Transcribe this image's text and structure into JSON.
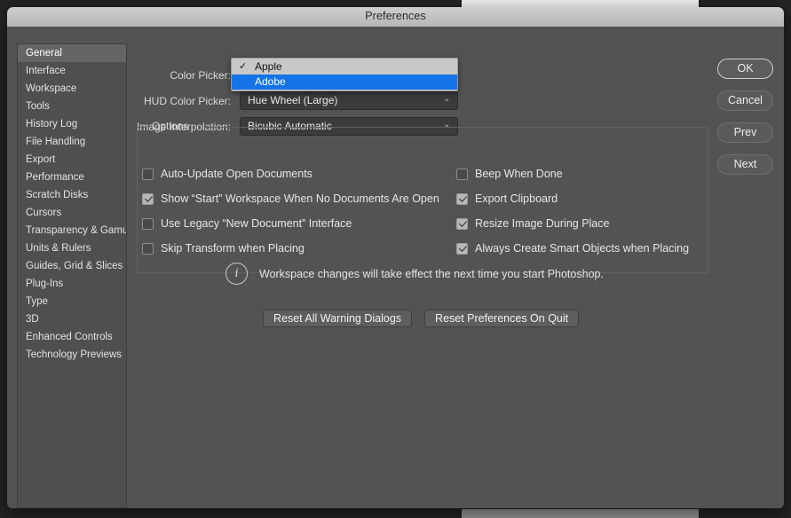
{
  "window": {
    "title": "Preferences"
  },
  "sidebar": {
    "items": [
      {
        "label": "General",
        "selected": true
      },
      {
        "label": "Interface",
        "selected": false
      },
      {
        "label": "Workspace",
        "selected": false
      },
      {
        "label": "Tools",
        "selected": false
      },
      {
        "label": "History Log",
        "selected": false
      },
      {
        "label": "File Handling",
        "selected": false
      },
      {
        "label": "Export",
        "selected": false
      },
      {
        "label": "Performance",
        "selected": false
      },
      {
        "label": "Scratch Disks",
        "selected": false
      },
      {
        "label": "Cursors",
        "selected": false
      },
      {
        "label": "Transparency & Gamut",
        "selected": false
      },
      {
        "label": "Units & Rulers",
        "selected": false
      },
      {
        "label": "Guides, Grid & Slices",
        "selected": false
      },
      {
        "label": "Plug-Ins",
        "selected": false
      },
      {
        "label": "Type",
        "selected": false
      },
      {
        "label": "3D",
        "selected": false
      },
      {
        "label": "Enhanced Controls",
        "selected": false
      },
      {
        "label": "Technology Previews",
        "selected": false
      }
    ]
  },
  "form": {
    "color_picker": {
      "label": "Color Picker:",
      "value": "Apple",
      "open": true,
      "options": [
        {
          "label": "Apple",
          "checked": true,
          "highlighted": false
        },
        {
          "label": "Adobe",
          "checked": false,
          "highlighted": true
        }
      ]
    },
    "hud_color_picker": {
      "label": "HUD Color Picker:",
      "value": "Hue Wheel (Large)"
    },
    "image_interpolation": {
      "label": "Image Interpolation:",
      "value": "Bicubic Automatic"
    },
    "chevron": "⌄"
  },
  "options": {
    "legend": "Options",
    "left_column": [
      {
        "label": "Auto-Update Open Documents",
        "checked": false
      },
      {
        "label": "Show “Start” Workspace When No Documents Are Open",
        "checked": true
      },
      {
        "label": "Use Legacy “New Document” Interface",
        "checked": false
      },
      {
        "label": "Skip Transform when Placing",
        "checked": false
      }
    ],
    "right_column": [
      {
        "label": "Beep When Done",
        "checked": false
      },
      {
        "label": "Export Clipboard",
        "checked": true
      },
      {
        "label": "Resize Image During Place",
        "checked": true
      },
      {
        "label": "Always Create Smart Objects when Placing",
        "checked": true
      }
    ]
  },
  "info": {
    "icon": "info-icon",
    "glyph": "i",
    "text": "Workspace changes will take effect the next time you start Photoshop."
  },
  "reset_buttons": [
    {
      "label": "Reset All Warning Dialogs"
    },
    {
      "label": "Reset Preferences On Quit"
    }
  ],
  "action_buttons": [
    {
      "label": "OK",
      "default": true
    },
    {
      "label": "Cancel",
      "default": false
    },
    {
      "label": "Prev",
      "default": false
    },
    {
      "label": "Next",
      "default": false
    }
  ],
  "colors": {
    "dialog_bg": "#535353",
    "titlebar": "#bfbfbf",
    "highlight_blue": "#1473e6",
    "popup_bg": "#c8c8c8",
    "select_bg": "#3b3b3b"
  }
}
